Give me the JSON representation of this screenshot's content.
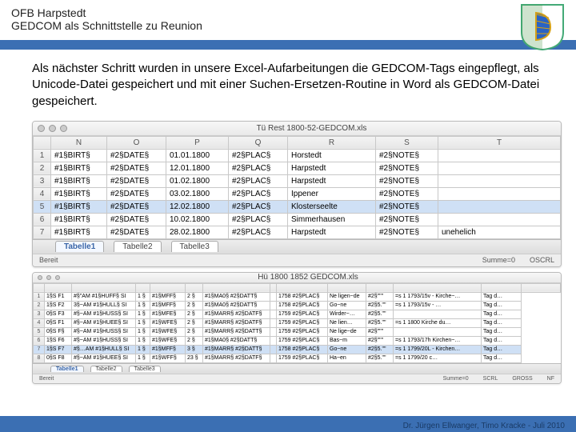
{
  "header": {
    "line1": "OFB Harpstedt",
    "line2": "GEDCOM als Schnittstelle zu Reunion"
  },
  "body_text": "Als nächster Schritt wurden in unsere Excel-Aufarbeitungen die GEDCOM-Tags eingepflegt, als Unicode-Datei gespeichert und mit einer Suchen-Ersetzen-Routine in Word als GEDCOM-Datei gespeichert.",
  "win1": {
    "title": "Tü Rest 1800-52-GEDCOM.xls",
    "cols": [
      "",
      "N",
      "O",
      "P",
      "Q",
      "R",
      "S",
      "T"
    ],
    "rows": [
      [
        "1",
        "#1§BIRT§",
        "#2§DATE§",
        "01.01.1800",
        "#2§PLAC§",
        "Horstedt",
        "#2§NOTE§",
        ""
      ],
      [
        "2",
        "#1§BIRT§",
        "#2§DATE§",
        "12.01.1800",
        "#2§PLAC§",
        "Harpstedt",
        "#2§NOTE§",
        ""
      ],
      [
        "3",
        "#1§BIRT§",
        "#2§DATE§",
        "01.02.1800",
        "#2§PLAC§",
        "Harpstedt",
        "#2§NOTE§",
        ""
      ],
      [
        "4",
        "#1§BIRT§",
        "#2§DATE§",
        "03.02.1800",
        "#2§PLAC§",
        "Ippener",
        "#2§NOTE§",
        ""
      ],
      [
        "5",
        "#1§BIRT§",
        "#2§DATE§",
        "12.02.1800",
        "#2§PLAC§",
        "Klosterseelte",
        "#2§NOTE§",
        ""
      ],
      [
        "6",
        "#1§BIRT§",
        "#2§DATE§",
        "10.02.1800",
        "#2§PLAC§",
        "Simmerhausen",
        "#2§NOTE§",
        ""
      ],
      [
        "7",
        "#1§BIRT§",
        "#2§DATE§",
        "28.02.1800",
        "#2§PLAC§",
        "Harpstedt",
        "#2§NOTE§",
        "unehelich"
      ]
    ],
    "selected_row_index": 4,
    "tabs": [
      "Tabelle1",
      "Tabelle2",
      "Tabelle3"
    ],
    "active_tab": 0,
    "status_left": "Bereit",
    "status_sum": "Summe=0"
  },
  "win2": {
    "title": "Hü 1800 1852 GEDCOM.xls",
    "cols": [
      "",
      "",
      "",
      "",
      "",
      "",
      "",
      "",
      "",
      "",
      "",
      "",
      "",
      ""
    ],
    "head_letters": [
      "",
      "",
      "",
      "",
      "",
      "",
      "",
      "",
      "",
      "",
      "",
      "",
      "",
      ""
    ],
    "rows": [
      [
        "1",
        "1§S F1",
        "#§\"AM #1§HUFF§ SI",
        "1 §",
        "#1§MFF§",
        "2 §",
        "#1§MA0§ #2§DATT§",
        "",
        "1758 #2§PLAC§",
        "Ne ligen~de",
        "#2§\"\"\"",
        "=s 1 1793/15v - Kirche~…",
        "Tag d…"
      ],
      [
        "2",
        "1§S F2",
        "3§~AM #1§HULL§ SI",
        "1 §",
        "#1§MFF§",
        "2 §",
        "#1§MA0§ #2§DATT§",
        "",
        "1758 #2§PLAC§",
        "Go~ne",
        "#2§5.\"\"",
        "=s 1 1793/15v - …",
        "Tag d…"
      ],
      [
        "3",
        "0§S F3",
        "#§~AM #1§HUSS§ SI",
        "1 §",
        "#1§MFE§",
        "2 §",
        "#1§MARR§ #2§DATF§",
        "",
        "1759 #2§PLAC§",
        "Wirder~…",
        "#2§5.\"\"",
        "",
        "Tag d…"
      ],
      [
        "4",
        "0§S F1",
        "#§~AM #1§HUEE§ SI",
        "1 §",
        "#1§WFE§",
        "2 §",
        "#1§MARR§ #2§DATF§",
        "",
        "1759 #2§PLAC§",
        "Ne lien…",
        "#2§5.\"\"",
        "=s 1 1800 Kirche du…",
        "Tag d…"
      ],
      [
        "5",
        "0§S F§",
        "#§~AM #1§HUSS§ SI",
        "1 §",
        "#1§WFE§",
        "2 §",
        "#1§MARR§ #2§DATT§",
        "",
        "1759 #2§PLAC§",
        "Ne lige~de",
        "#2§\"\"\"",
        "",
        "Tag d…"
      ],
      [
        "6",
        "1§S F6",
        "#§~AM #1§HUSS§ SI",
        "1 §",
        "#1§WFE§",
        "2 §",
        "#1§MA0§ #2§DATT§",
        "",
        "1759 #2§PLAC§",
        "Bas~m",
        "#2§\"\"\"",
        "=s 1 1793/17h Kirchen~…",
        "Tag d…"
      ],
      [
        "7",
        "1§S F7",
        "#§…AM #1§HULL§ SI",
        "1 §",
        "#1§MFF§",
        "3 §",
        "#1§MARR§ #2§DATT§",
        "",
        "1758 #2§PLAC§",
        "Go~ne",
        "#2§5.\"\"",
        "=s 1 1799/20L - Kirchen…",
        "Tag d…"
      ],
      [
        "8",
        "0§S F8",
        "#§~AM #1§HUEE§ SI",
        "1 §",
        "#1§WFF§",
        "23 §",
        "#1§MARR§ #2§DATF§",
        "",
        "1759 #2§PLAC§",
        "Ha~en",
        "#2§5.\"\"",
        "=s 1 1799/20 c…",
        "Tag d…"
      ]
    ],
    "selected_row_index": 6,
    "tabs": [
      "Tabelle1",
      "Tabelle2",
      "Tabelle3"
    ],
    "active_tab": 0,
    "status_left": "Bereit",
    "status_sum": "Summe=0",
    "status_extra": [
      "SCRL",
      "GROSS",
      "NF"
    ]
  },
  "footer": "Dr. Jürgen Ellwanger, Timo Kracke - Juli 2010"
}
